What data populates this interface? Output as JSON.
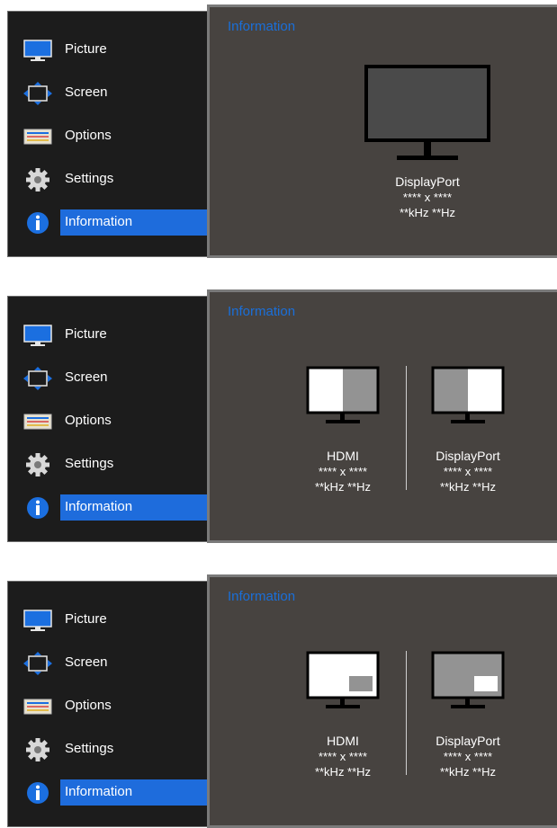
{
  "menu": {
    "items": [
      {
        "label": "Picture",
        "icon": "monitor-icon"
      },
      {
        "label": "Screen",
        "icon": "screen-adjust-icon"
      },
      {
        "label": "Options",
        "icon": "options-sliders-icon"
      },
      {
        "label": "Settings",
        "icon": "gear-icon"
      },
      {
        "label": "Information",
        "icon": "info-icon",
        "selected": true
      }
    ]
  },
  "panels": [
    {
      "title": "Information",
      "sources": [
        {
          "name": "DisplayPort",
          "resolution": "**** x ****",
          "frequency": "**kHz **Hz"
        }
      ]
    },
    {
      "title": "Information",
      "mode": "PBP",
      "sources": [
        {
          "name": "HDMI",
          "resolution": "**** x ****",
          "frequency": "**kHz **Hz"
        },
        {
          "name": "DisplayPort",
          "resolution": "**** x ****",
          "frequency": "**kHz **Hz"
        }
      ]
    },
    {
      "title": "Information",
      "mode": "PIP",
      "sources": [
        {
          "name": "HDMI",
          "resolution": "**** x ****",
          "frequency": "**kHz **Hz"
        },
        {
          "name": "DisplayPort",
          "resolution": "**** x ****",
          "frequency": "**kHz **Hz"
        }
      ]
    }
  ],
  "colors": {
    "accent": "#1e6cdc",
    "title": "#1a6fd9",
    "panel_bg": "#474340",
    "sidebar_bg": "#1c1c1c"
  }
}
